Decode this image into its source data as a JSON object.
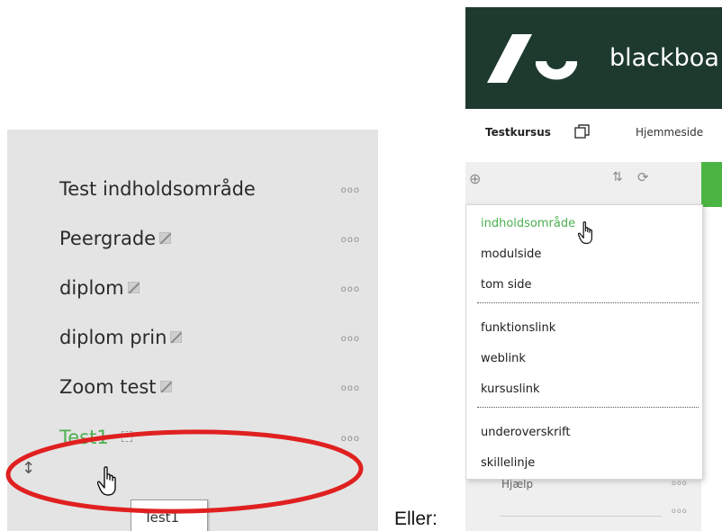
{
  "left": {
    "items": [
      {
        "label": "Test indholdsområde",
        "hidden": false,
        "active": false,
        "more": "ooo"
      },
      {
        "label": "Peergrade",
        "hidden": true,
        "active": false,
        "more": "ooo"
      },
      {
        "label": "diplom",
        "hidden": true,
        "active": false,
        "more": "ooo"
      },
      {
        "label": "diplom prin",
        "hidden": true,
        "active": false,
        "more": "ooo"
      },
      {
        "label": "Zoom test",
        "hidden": true,
        "active": false,
        "more": "ooo"
      },
      {
        "label": "Test1",
        "hidden": false,
        "active": true,
        "more": "ooo"
      }
    ],
    "drag_handle": "↕",
    "tooltip": "Test1",
    "highlight_color": "#e02020",
    "active_color": "#4caf50"
  },
  "caption": "Eller:",
  "right": {
    "brand_name": "blackboa",
    "header_color": "#1e3a2f",
    "course_name": "Testkursus",
    "home_link": "Hjemmeside",
    "toolbar_icons": [
      "add-icon",
      "sort-icon",
      "refresh-icon"
    ],
    "dropdown": {
      "groups": [
        [
          "indholdsområde",
          "modulside",
          "tom side"
        ],
        [
          "funktionslink",
          "weblink",
          "kursuslink"
        ],
        [
          "underoverskrift",
          "skillelinje"
        ]
      ],
      "active_item": "indholdsområde"
    },
    "partial_item": "Hjælp",
    "more": "ooo"
  }
}
